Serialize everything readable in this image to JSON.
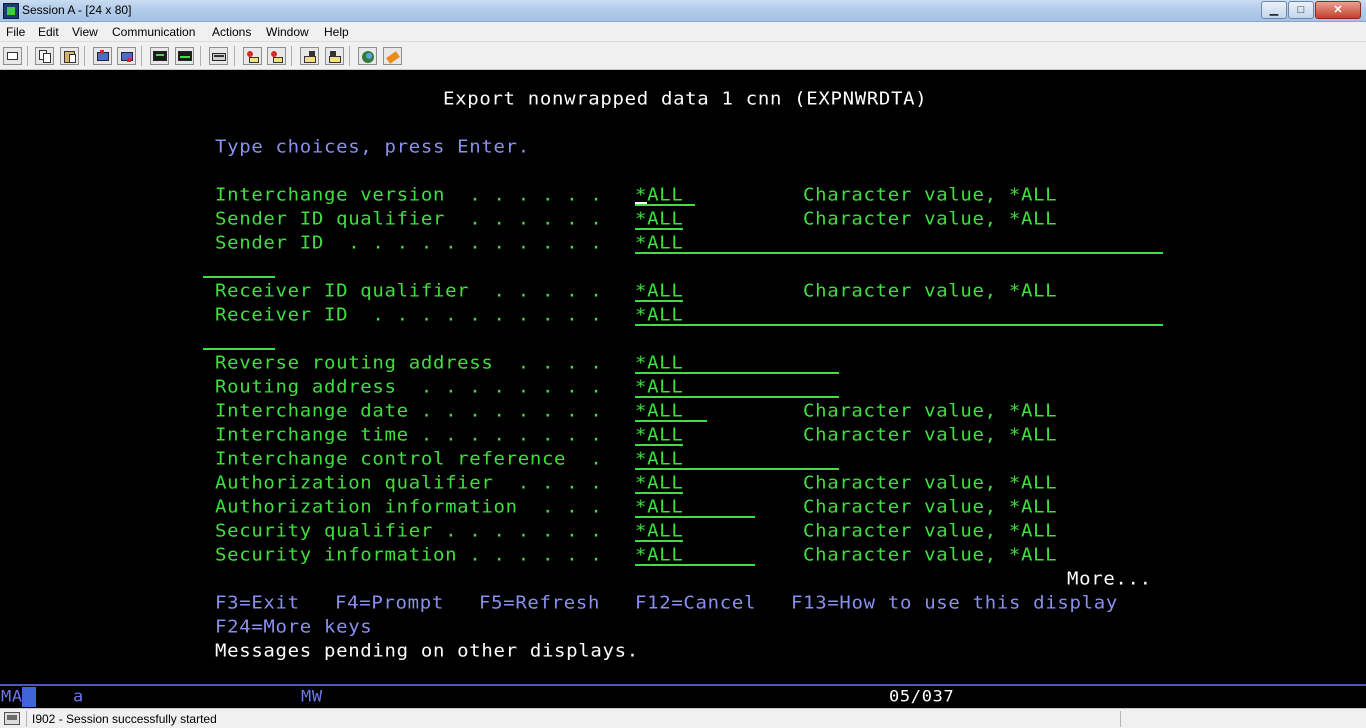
{
  "window": {
    "title": "Session A - [24 x 80]",
    "controls": {
      "minimize": "▁",
      "maximize": "□",
      "close": "✕"
    }
  },
  "menu": [
    "File",
    "Edit",
    "View",
    "Communication",
    "Actions",
    "Window",
    "Help"
  ],
  "toolbar": {
    "icons": [
      "print-screen-icon",
      "copy-icon",
      "paste-icon",
      "send-icon",
      "receive-icon",
      "display-icon",
      "keyboard-icon",
      "macro-icon",
      "record-macro-icon",
      "play-macro-icon",
      "stop-macro-icon",
      "support-icon",
      "customize-icon"
    ]
  },
  "screen": {
    "title": "Export nonwrapped data 1 cnn (EXPNWRDTA)",
    "instruction": "Type choices, press Enter.",
    "fields": [
      {
        "label": "Interchange version  . . . . . .",
        "value": "*ALL",
        "hint": "Character value, *ALL"
      },
      {
        "label": "Sender ID qualifier  . . . . . .",
        "value": "*ALL",
        "hint": "Character value, *ALL"
      },
      {
        "label": "Sender ID  . . . . . . . . . . .",
        "value": "*ALL",
        "hint": ""
      },
      {
        "label": "Receiver ID qualifier  . . . . .",
        "value": "*ALL",
        "hint": "Character value, *ALL"
      },
      {
        "label": "Receiver ID  . . . . . . . . . .",
        "value": "*ALL",
        "hint": ""
      },
      {
        "label": "Reverse routing address  . . . .",
        "value": "*ALL",
        "hint": ""
      },
      {
        "label": "Routing address  . . . . . . . .",
        "value": "*ALL",
        "hint": ""
      },
      {
        "label": "Interchange date . . . . . . . .",
        "value": "*ALL",
        "hint": "Character value, *ALL"
      },
      {
        "label": "Interchange time . . . . . . . .",
        "value": "*ALL",
        "hint": "Character value, *ALL"
      },
      {
        "label": "Interchange control reference  .",
        "value": "*ALL",
        "hint": ""
      },
      {
        "label": "Authorization qualifier  . . . .",
        "value": "*ALL",
        "hint": "Character value, *ALL"
      },
      {
        "label": "Authorization information  . . .",
        "value": "*ALL",
        "hint": "Character value, *ALL"
      },
      {
        "label": "Security qualifier . . . . . . .",
        "value": "*ALL",
        "hint": "Character value, *ALL"
      },
      {
        "label": "Security information . . . . . .",
        "value": "*ALL",
        "hint": "Character value, *ALL"
      }
    ],
    "more": "More...",
    "function_keys_1": [
      "F3=Exit",
      "F4=Prompt",
      "F5=Refresh",
      "F12=Cancel",
      "F13=How to use this display"
    ],
    "function_keys_2": "F24=More keys",
    "message": "Messages pending on other displays."
  },
  "oia": {
    "indicator": "MA",
    "session_letter": "a",
    "mode": "MW",
    "cursor_position": "05/037"
  },
  "status": {
    "message": "I902 - Session successfully started"
  }
}
